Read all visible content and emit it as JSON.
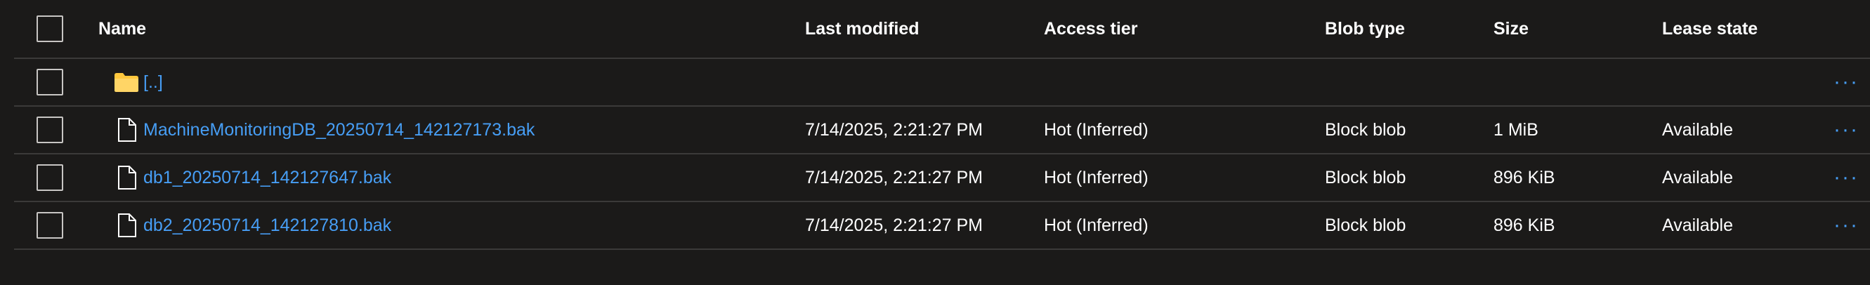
{
  "columns": {
    "name": "Name",
    "last_modified": "Last modified",
    "access_tier": "Access tier",
    "blob_type": "Blob type",
    "size": "Size",
    "lease_state": "Lease state"
  },
  "parent_row": {
    "name": "[..]",
    "icon": "folder-icon",
    "more": "···"
  },
  "rows": [
    {
      "name": "MachineMonitoringDB_20250714_142127173.bak",
      "icon": "file-icon",
      "last_modified": "7/14/2025, 2:21:27 PM",
      "access_tier": "Hot (Inferred)",
      "blob_type": "Block blob",
      "size": "1 MiB",
      "lease_state": "Available",
      "more": "···"
    },
    {
      "name": "db1_20250714_142127647.bak",
      "icon": "file-icon",
      "last_modified": "7/14/2025, 2:21:27 PM",
      "access_tier": "Hot (Inferred)",
      "blob_type": "Block blob",
      "size": "896 KiB",
      "lease_state": "Available",
      "more": "···"
    },
    {
      "name": "db2_20250714_142127810.bak",
      "icon": "file-icon",
      "last_modified": "7/14/2025, 2:21:27 PM",
      "access_tier": "Hot (Inferred)",
      "blob_type": "Block blob",
      "size": "896 KiB",
      "lease_state": "Available",
      "more": "···"
    }
  ],
  "colors": {
    "background": "#1b1a19",
    "link": "#479ef5",
    "folder": "#ffc83d",
    "divider": "#3b3a39"
  }
}
